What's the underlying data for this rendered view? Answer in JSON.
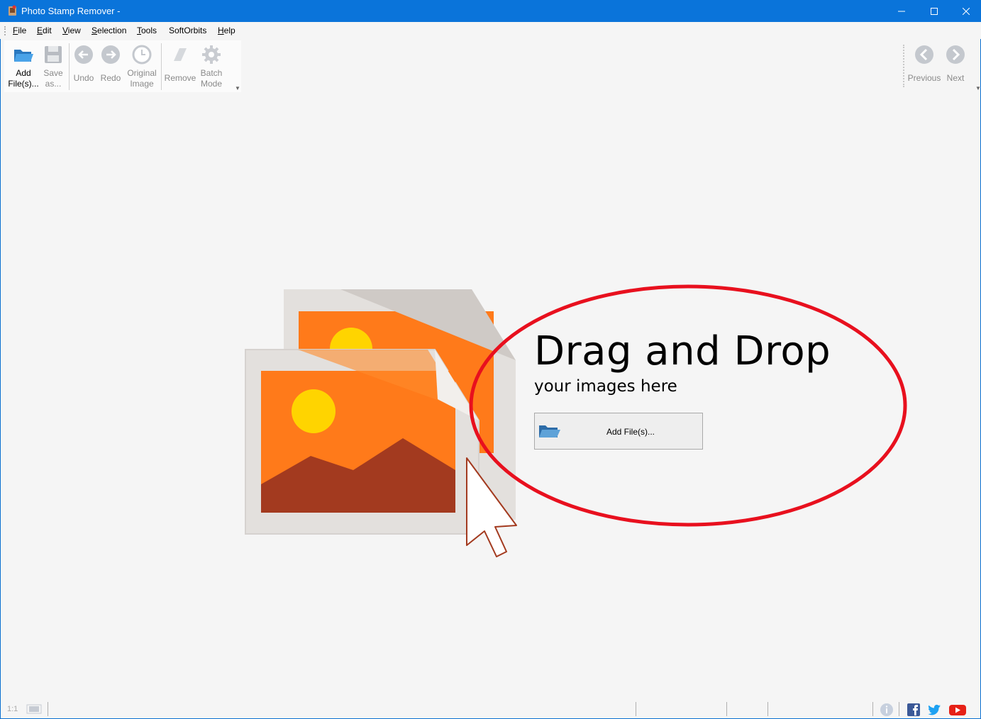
{
  "window": {
    "title": "Photo Stamp Remover -",
    "controls": [
      "minimize",
      "maximize",
      "close"
    ],
    "titlebar_color": "#0a74da"
  },
  "menu": {
    "file": {
      "pre": "",
      "ul": "F",
      "post": "ile"
    },
    "edit": {
      "pre": "",
      "ul": "E",
      "post": "dit"
    },
    "view": {
      "pre": "",
      "ul": "V",
      "post": "iew"
    },
    "selection": {
      "pre": "",
      "ul": "S",
      "post": "election"
    },
    "tools": {
      "pre": "",
      "ul": "T",
      "post": "ools"
    },
    "softorbits": {
      "pre": "SoftOrbits",
      "ul": "",
      "post": ""
    },
    "help": {
      "pre": "",
      "ul": "H",
      "post": "elp"
    }
  },
  "toolbar": {
    "add_files": "Add\nFile(s)...",
    "save_as": "Save\nas...",
    "undo": "Undo",
    "redo": "Redo",
    "original_image": "Original\nImage",
    "remove": "Remove",
    "batch_mode": "Batch\nMode"
  },
  "nav": {
    "previous": "Previous",
    "next": "Next"
  },
  "dropzone": {
    "title": "Drag and Drop",
    "subtitle": "your images here",
    "button_label": "Add File(s)...",
    "highlight_color": "#e8101e"
  },
  "status": {
    "zoom": "1:1"
  },
  "icons": {
    "app": "photo-stamp-remover-icon",
    "add_files": "folder-open-icon",
    "save_as": "floppy-disk-icon",
    "undo": "arrow-left-circle-icon",
    "redo": "arrow-right-circle-icon",
    "original_image": "clock-icon",
    "remove": "eraser-icon",
    "batch_mode": "gear-icon",
    "previous": "chevron-left-circle-icon",
    "next": "chevron-right-circle-icon",
    "info": "info-icon",
    "facebook": "facebook-icon",
    "twitter": "twitter-icon",
    "youtube": "youtube-icon"
  }
}
